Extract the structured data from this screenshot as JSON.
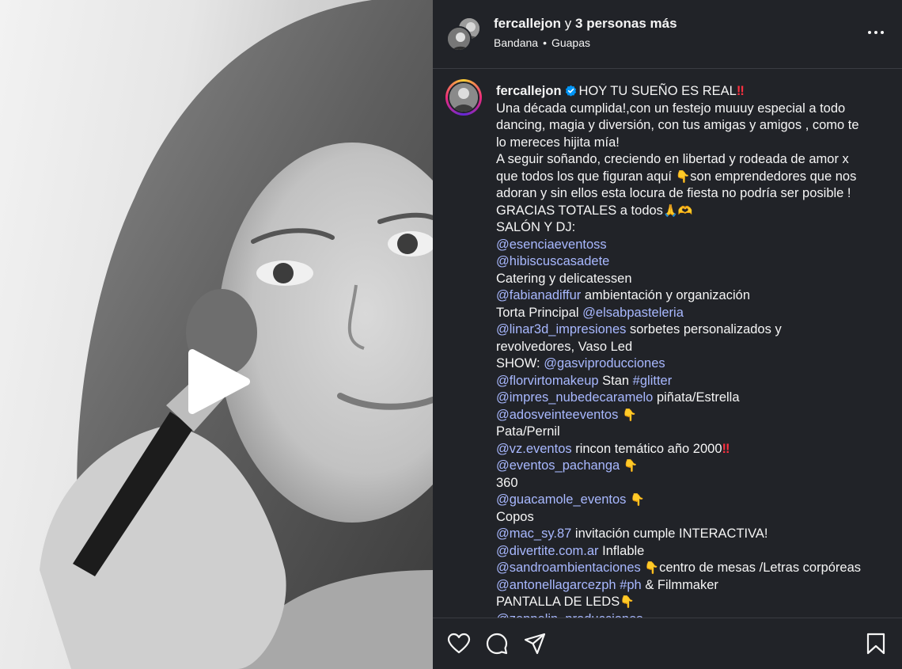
{
  "header": {
    "username": "fercallejon",
    "joiner": "y",
    "others": "3 personas más",
    "audio_track": "Bandana",
    "separator": "•",
    "audio_artist": "Guapas"
  },
  "media": {
    "type": "video",
    "play_icon": "play-icon"
  },
  "caption": {
    "username": "fercallejon",
    "verified_icon": "verified-badge-icon",
    "lines": [
      [
        {
          "t": "text",
          "v": "HOY TU SUEÑO ES REAL"
        },
        {
          "t": "red",
          "v": "‼"
        }
      ],
      [
        {
          "t": "text",
          "v": "Una década cumplida!,con un festejo muuuy especial a todo"
        }
      ],
      [
        {
          "t": "text",
          "v": "dancing, magia y diversión, con tus amigas y amigos , como te"
        }
      ],
      [
        {
          "t": "text",
          "v": "lo mereces hijita mía!"
        }
      ],
      [
        {
          "t": "text",
          "v": "A seguir soñando, creciendo en libertad y rodeada de amor x"
        }
      ],
      [
        {
          "t": "text",
          "v": "que todos los que figuran aquí "
        },
        {
          "t": "emoji",
          "v": "👇"
        },
        {
          "t": "text",
          "v": "son emprendedores que nos"
        }
      ],
      [
        {
          "t": "text",
          "v": "adoran y sin ellos esta locura de fiesta no podría ser posible !"
        }
      ],
      [
        {
          "t": "text",
          "v": "GRACIAS TOTALES a todos"
        },
        {
          "t": "emoji",
          "v": "🙏🫶"
        }
      ],
      [
        {
          "t": "text",
          "v": "SALÓN Y DJ:"
        }
      ],
      [
        {
          "t": "mention",
          "v": "@esenciaeventoss"
        }
      ],
      [
        {
          "t": "mention",
          "v": "@hibiscuscasadete"
        }
      ],
      [
        {
          "t": "text",
          "v": "Catering y delicatessen"
        }
      ],
      [
        {
          "t": "mention",
          "v": "@fabianadiffur"
        },
        {
          "t": "text",
          "v": " ambientación y organización"
        }
      ],
      [
        {
          "t": "text",
          "v": "Torta Principal "
        },
        {
          "t": "mention",
          "v": "@elsabpasteleria"
        }
      ],
      [
        {
          "t": "mention",
          "v": "@linar3d_impresiones"
        },
        {
          "t": "text",
          "v": " sorbetes personalizados y"
        }
      ],
      [
        {
          "t": "text",
          "v": "revolvedores, Vaso Led"
        }
      ],
      [
        {
          "t": "text",
          "v": "SHOW: "
        },
        {
          "t": "mention",
          "v": "@gasviproducciones"
        }
      ],
      [
        {
          "t": "mention",
          "v": "@florvirtomakeup"
        },
        {
          "t": "text",
          "v": " Stan "
        },
        {
          "t": "mention",
          "v": "#glitter"
        }
      ],
      [
        {
          "t": "mention",
          "v": "@impres_nubedecaramelo"
        },
        {
          "t": "text",
          "v": " piñata/Estrella"
        }
      ],
      [
        {
          "t": "mention",
          "v": "@adosveinteeventos"
        },
        {
          "t": "text",
          "v": " "
        },
        {
          "t": "emoji",
          "v": "👇"
        }
      ],
      [
        {
          "t": "text",
          "v": "Pata/Pernil"
        }
      ],
      [
        {
          "t": "mention",
          "v": "@vz.eventos"
        },
        {
          "t": "text",
          "v": " rincon temático año 2000"
        },
        {
          "t": "red",
          "v": "‼"
        }
      ],
      [
        {
          "t": "mention",
          "v": "@eventos_pachanga"
        },
        {
          "t": "text",
          "v": " "
        },
        {
          "t": "emoji",
          "v": "👇"
        }
      ],
      [
        {
          "t": "text",
          "v": "360"
        }
      ],
      [
        {
          "t": "mention",
          "v": "@guacamole_eventos"
        },
        {
          "t": "text",
          "v": " "
        },
        {
          "t": "emoji",
          "v": "👇"
        }
      ],
      [
        {
          "t": "text",
          "v": "Copos"
        }
      ],
      [
        {
          "t": "mention",
          "v": "@mac_sy.87"
        },
        {
          "t": "text",
          "v": " invitación cumple INTERACTIVA!"
        }
      ],
      [
        {
          "t": "mention",
          "v": "@divertite.com.ar"
        },
        {
          "t": "text",
          "v": " Inflable"
        }
      ],
      [
        {
          "t": "mention",
          "v": "@sandroambientaciones"
        },
        {
          "t": "text",
          "v": " "
        },
        {
          "t": "emoji",
          "v": "👇"
        },
        {
          "t": "text",
          "v": "centro de mesas /Letras corpóreas"
        }
      ],
      [
        {
          "t": "mention",
          "v": "@antonellagarcezph"
        },
        {
          "t": "text",
          "v": " "
        },
        {
          "t": "mention",
          "v": "#ph"
        },
        {
          "t": "text",
          "v": " & Filmmaker"
        }
      ],
      [
        {
          "t": "text",
          "v": "PANTALLA DE LEDS"
        },
        {
          "t": "emoji",
          "v": "👇"
        }
      ],
      [
        {
          "t": "mention",
          "v": "@zeppelin_producciones"
        }
      ]
    ]
  },
  "actions": {
    "like_icon": "heart-icon",
    "comment_icon": "comment-icon",
    "share_icon": "share-icon",
    "save_icon": "bookmark-icon"
  },
  "colors": {
    "panel_bg": "#212328",
    "mention": "#a8b8ff",
    "verified": "#0095f6"
  }
}
